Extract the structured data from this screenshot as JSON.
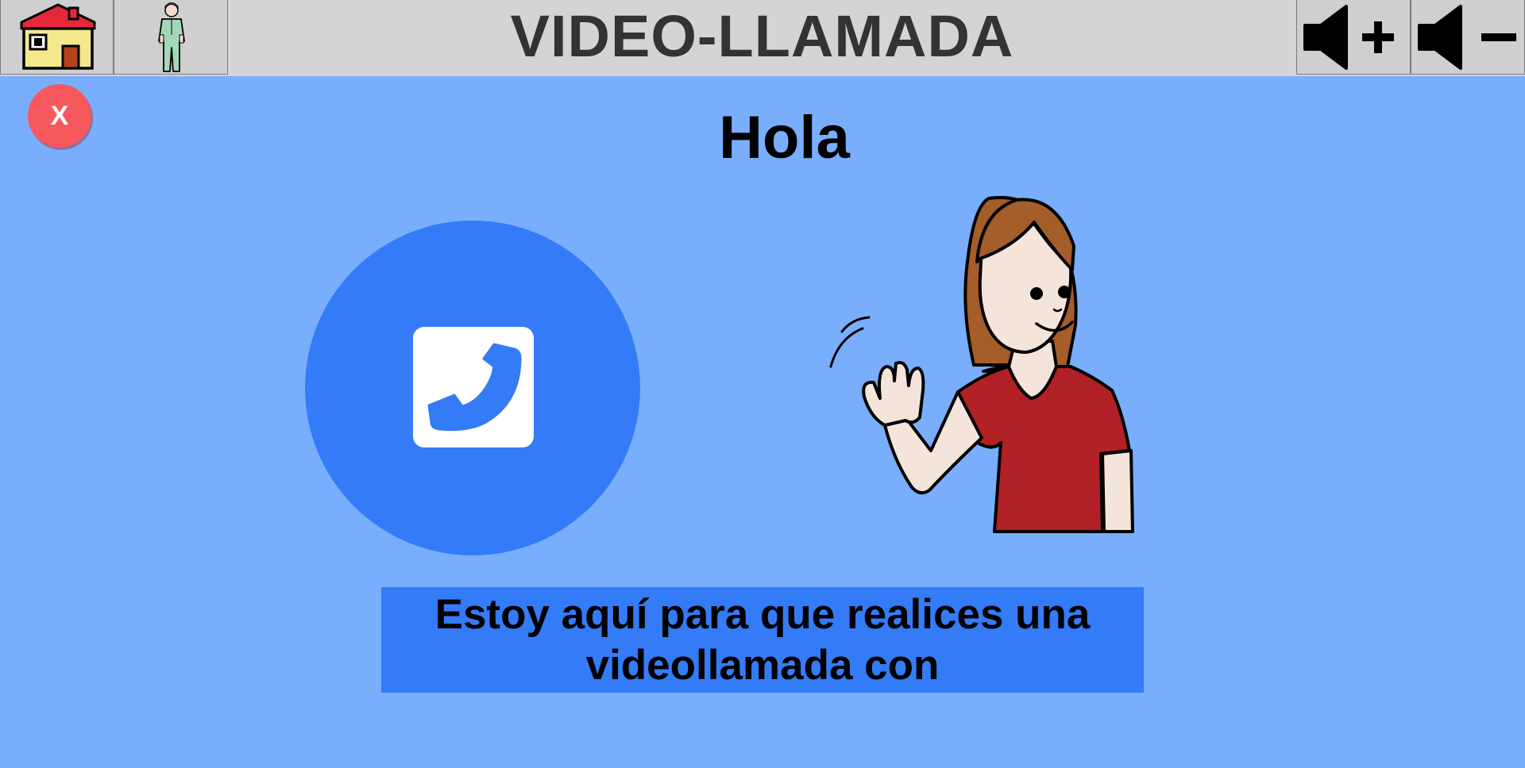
{
  "header": {
    "title": "VIDEO-LLAMADA",
    "home_icon": "house-icon",
    "profile_icon": "nurse-icon",
    "volume_up_icon": "volume-up-icon",
    "volume_down_icon": "volume-down-icon"
  },
  "close_button": {
    "label": "X",
    "color": "#f6585e"
  },
  "main": {
    "greeting": "Hola",
    "call_icon": "phone-icon",
    "illustration": "girl-waving-illustration",
    "message": "Estoy aquí para que realices una videollamada con"
  },
  "colors": {
    "background": "#78aefb",
    "accent": "#347bf8",
    "topbar": "#d4d4d4"
  }
}
